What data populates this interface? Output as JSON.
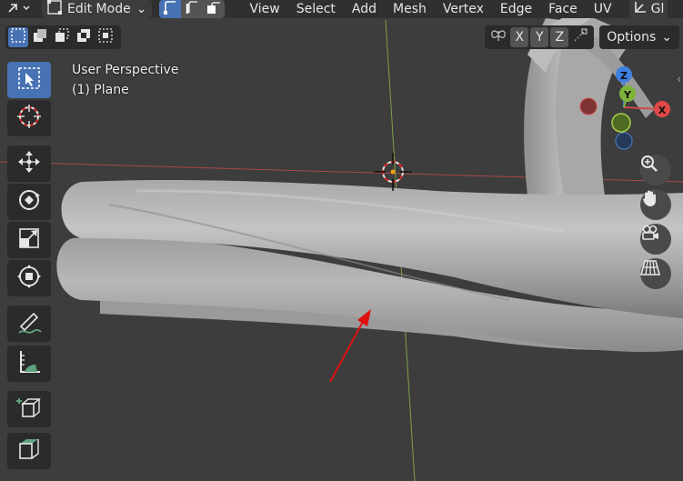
{
  "header": {
    "mode_label": "Edit Mode",
    "menus": [
      "View",
      "Select",
      "Add",
      "Mesh",
      "Vertex",
      "Edge",
      "Face",
      "UV"
    ],
    "cut_off_label": "Gl"
  },
  "toolheader": {
    "axes": [
      "X",
      "Y",
      "Z"
    ],
    "options_label": "Options"
  },
  "viewport": {
    "perspective_label": "User Perspective",
    "object_label": "(1) Plane"
  },
  "gizmo": {
    "z_label": "Z",
    "y_label": "Y",
    "x_label": "X"
  },
  "colors": {
    "accent": "#4772b3",
    "annotation_arrow": "#e01010",
    "x_axis_line": "#b54b4b",
    "y_axis_line": "#8ab04a"
  }
}
